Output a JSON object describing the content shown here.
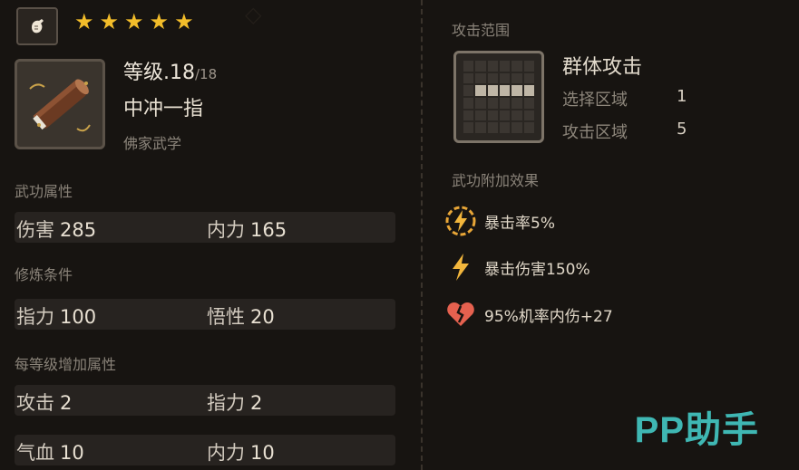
{
  "header": {
    "type_icon": "fist-icon",
    "stars": [
      "★",
      "★",
      "★",
      "★",
      "★"
    ],
    "star_color": "#f3bd2a"
  },
  "skill": {
    "icon": "scroll-icon",
    "level_text": "等级.18",
    "level_max": "/18",
    "name": "中冲一指",
    "school": "佛家武学"
  },
  "sections": {
    "attributes_title": "武功属性",
    "requirements_title": "修炼条件",
    "per_level_title": "每等级增加属性"
  },
  "attributes": [
    {
      "label": "伤害",
      "value": "285"
    },
    {
      "label": "内力",
      "value": "165"
    }
  ],
  "requirements": [
    {
      "label": "指力",
      "value": "100"
    },
    {
      "label": "悟性",
      "value": "20"
    }
  ],
  "per_level": [
    {
      "label": "攻击",
      "value": "2"
    },
    {
      "label": "指力",
      "value": "2"
    },
    {
      "label": "气血",
      "value": "10"
    },
    {
      "label": "内力",
      "value": "10"
    }
  ],
  "range": {
    "title": "攻击范围",
    "type": "群体攻击",
    "select_label": "选择区域",
    "select_value": "1",
    "attack_label": "攻击区域",
    "attack_value": "5"
  },
  "effects": {
    "title": "武功附加效果",
    "items": [
      {
        "icon": "lightning-circle-icon",
        "text": "暴击率5%"
      },
      {
        "icon": "lightning-icon",
        "text": "暴击伤害150%"
      },
      {
        "icon": "broken-heart-icon",
        "text": "95%机率内伤+27"
      }
    ]
  },
  "watermark": "PP助手"
}
